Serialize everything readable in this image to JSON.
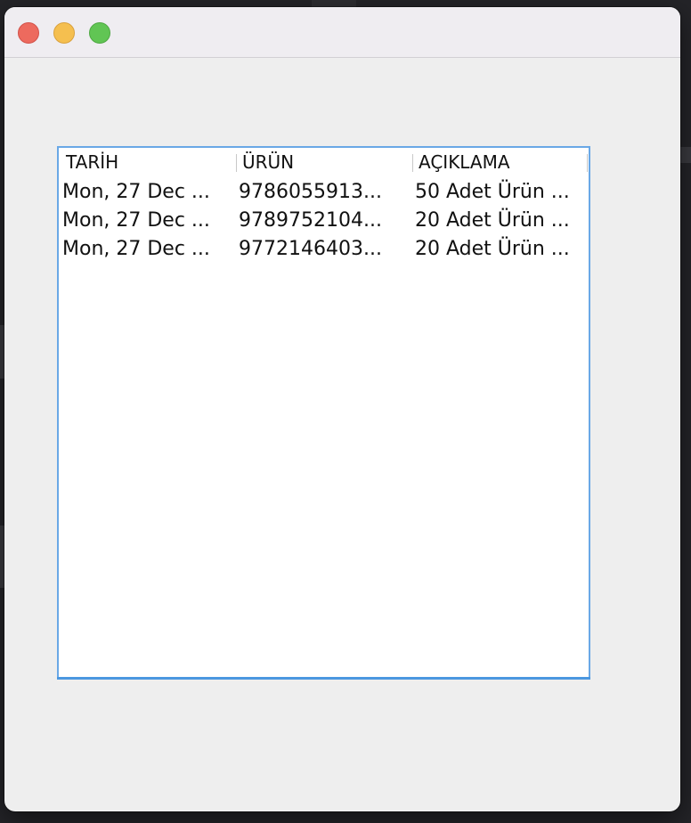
{
  "table": {
    "columns": [
      "TARİH",
      "ÜRÜN",
      "AÇIKLAMA"
    ],
    "rows": [
      [
        "Mon, 27 Dec ...",
        "9786055913...",
        "50 Adet Ürün ..."
      ],
      [
        "Mon, 27 Dec ...",
        "9789752104...",
        "20 Adet Ürün ..."
      ],
      [
        "Mon, 27 Dec ...",
        "9772146403...",
        "20 Adet Ürün ..."
      ]
    ]
  },
  "colors": {
    "window_bg": "#eeeeee",
    "titlebar_bg": "#efedf1",
    "table_border": "#6aa8e6",
    "close": "#ed6a5e",
    "minimize": "#f5bf4f",
    "zoom": "#61c554"
  }
}
